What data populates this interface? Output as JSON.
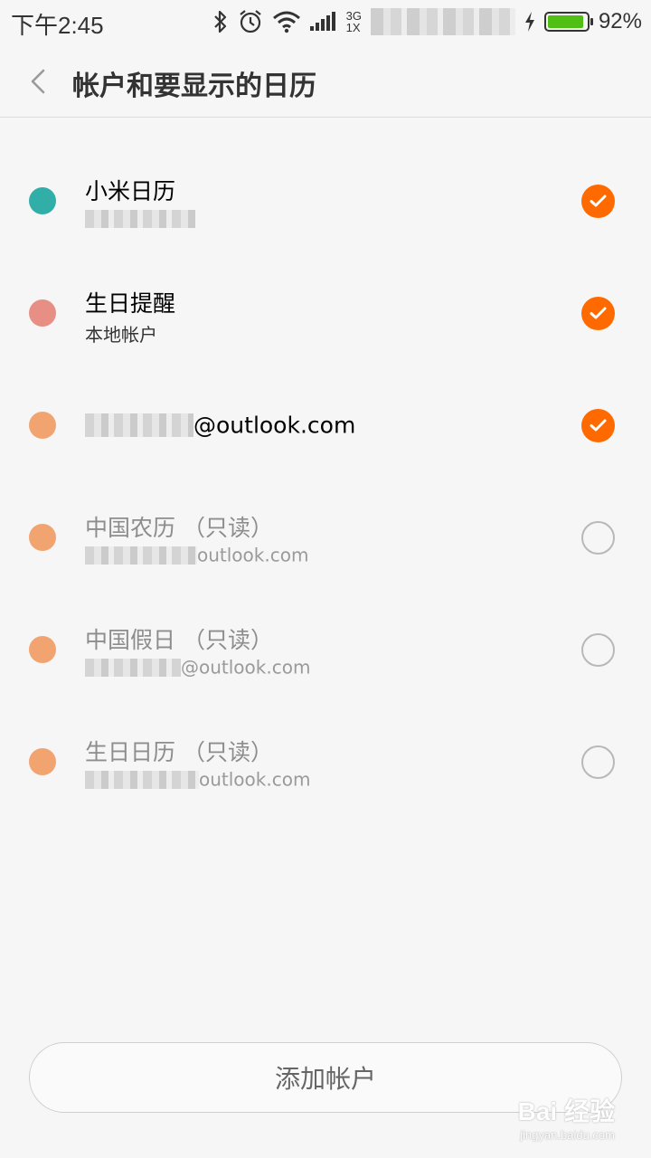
{
  "status_bar": {
    "time": "下午2:45",
    "network_top": "3G",
    "network_bottom": "1X",
    "battery_percent": "92%",
    "battery_level": 0.92,
    "icons": [
      "bluetooth-icon",
      "alarm-icon",
      "wifi-icon",
      "signal-icon",
      "charging-icon",
      "battery-icon"
    ]
  },
  "header": {
    "title": "帐户和要显示的日历",
    "back_icon": "chevron-left-icon"
  },
  "calendars": [
    {
      "title": "小米日历",
      "subtitle": "",
      "color": "#32aea8",
      "checked": true,
      "title_blur": false,
      "sub_blur": true
    },
    {
      "title": "生日提醒",
      "subtitle": "本地帐户",
      "color": "#e88f85",
      "checked": true,
      "title_blur": false,
      "sub_blur": false
    },
    {
      "title": "@outlook.com",
      "subtitle": "",
      "color": "#f2a470",
      "checked": true,
      "title_blur": true,
      "sub_blur": false
    },
    {
      "title": "中国农历 （只读）",
      "subtitle": "outlook.com",
      "color": "#f2a470",
      "checked": false,
      "title_blur": false,
      "sub_blur": true
    },
    {
      "title": "中国假日 （只读）",
      "subtitle": "@outlook.com",
      "color": "#f2a470",
      "checked": false,
      "title_blur": false,
      "sub_blur": true
    },
    {
      "title": "生日日历 （只读）",
      "subtitle": "outlook.com",
      "color": "#f2a470",
      "checked": false,
      "title_blur": false,
      "sub_blur": true
    }
  ],
  "add_account_label": "添加帐户",
  "watermark": {
    "main": "Bai 经验",
    "sub": "jingyan.baidu.com"
  },
  "colors": {
    "accent": "#ff6a00",
    "background": "#f6f6f6"
  }
}
